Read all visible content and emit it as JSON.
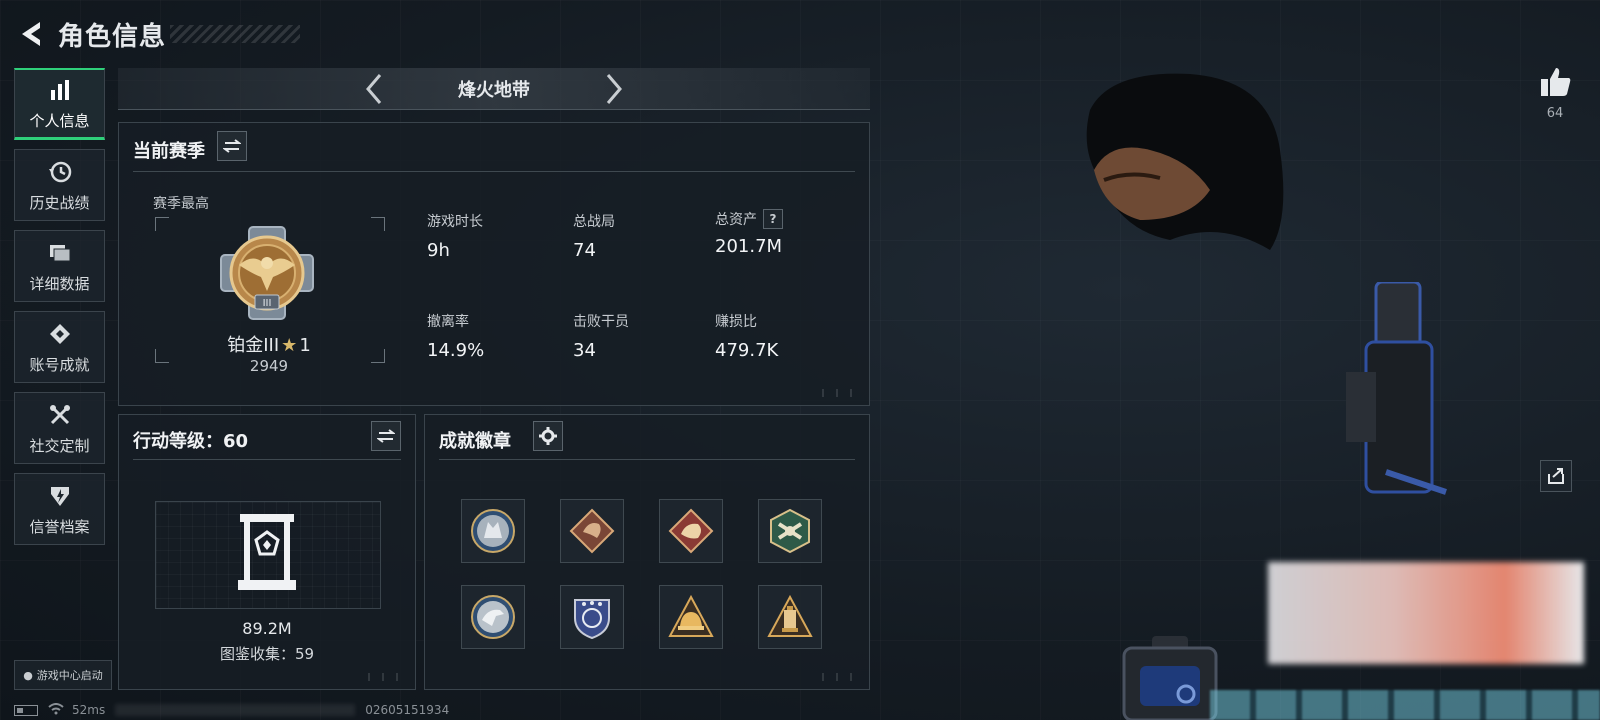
{
  "header": {
    "title": "角色信息"
  },
  "sidebar": {
    "items": [
      {
        "label": "个人信息",
        "icon": "bar-chart-icon",
        "active": true
      },
      {
        "label": "历史战绩",
        "icon": "history-icon",
        "active": false
      },
      {
        "label": "详细数据",
        "icon": "folder-icon",
        "active": false
      },
      {
        "label": "账号成就",
        "icon": "achievement-icon",
        "active": false
      },
      {
        "label": "社交定制",
        "icon": "tools-icon",
        "active": false
      },
      {
        "label": "信誉档案",
        "icon": "shield-icon",
        "active": false
      }
    ],
    "game_center": "游戏中心启动"
  },
  "mode": {
    "name": "烽火地带"
  },
  "season": {
    "title": "当前赛季",
    "best_label": "赛季最高",
    "rank": {
      "name": "铂金III",
      "star": "★",
      "stars": "1",
      "points": "2949"
    },
    "stats": [
      {
        "label": "游戏时长",
        "value": "9h"
      },
      {
        "label": "总战局",
        "value": "74"
      },
      {
        "label": "总资产",
        "value": "201.7M",
        "help": "?"
      },
      {
        "label": "撤离率",
        "value": "14.9%"
      },
      {
        "label": "击败干员",
        "value": "34"
      },
      {
        "label": "赚损比",
        "value": "479.7K"
      }
    ]
  },
  "level": {
    "title": "行动等级：60",
    "value": "89.2M",
    "collection": "图鉴收集：59"
  },
  "achievements": {
    "title": "成就徽章",
    "badges": [
      "wolf-badge-icon",
      "dragon-badge-icon",
      "snake-badge-icon",
      "hornet-badge-icon",
      "eagle-badge-icon",
      "police-shield-badge-icon",
      "helmet-badge-icon",
      "lantern-badge-icon"
    ]
  },
  "social": {
    "likes": "64"
  },
  "status": {
    "ping": "52ms",
    "id": "02605151934"
  },
  "colors": {
    "accent": "#2fd07a",
    "badge_gold": "#c89a4a",
    "badge_blue": "#2f4e72"
  }
}
